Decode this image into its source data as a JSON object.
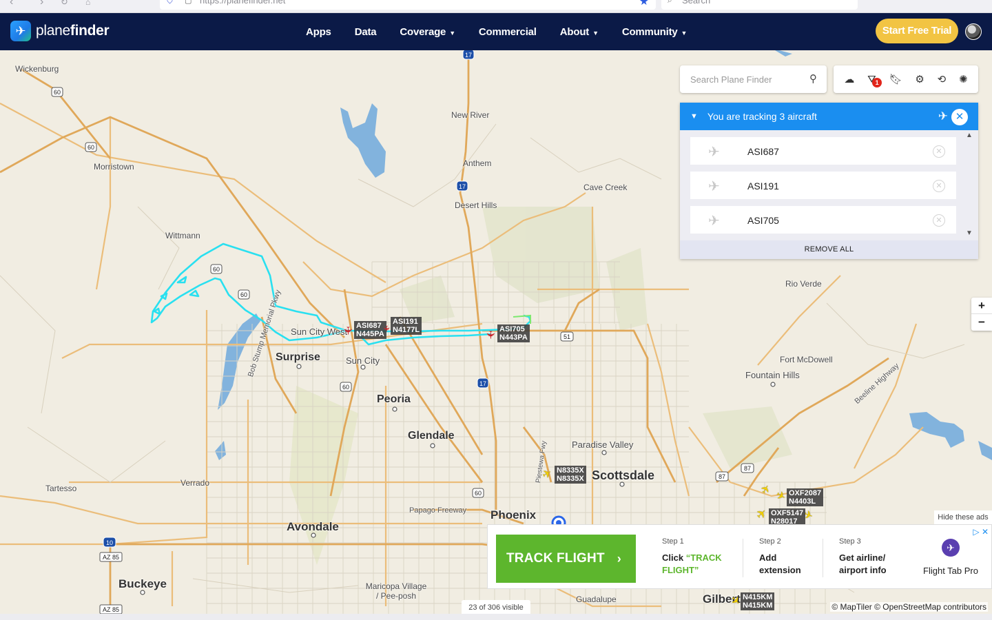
{
  "browser": {
    "url": "https://planefinder.net",
    "search_placeholder": "Search"
  },
  "header": {
    "brand_light": "plane",
    "brand_bold": "finder",
    "nav": [
      {
        "label": "Apps",
        "dropdown": false
      },
      {
        "label": "Data",
        "dropdown": false
      },
      {
        "label": "Coverage",
        "dropdown": true
      },
      {
        "label": "Commercial",
        "dropdown": false
      },
      {
        "label": "About",
        "dropdown": true
      },
      {
        "label": "Community",
        "dropdown": true
      }
    ],
    "cta": "Start Free Trial",
    "colors": {
      "bar": "#0b1a47",
      "cta": "#f2c443"
    }
  },
  "map_search": {
    "placeholder": "Search Plane Finder"
  },
  "toolbar": {
    "icons": [
      "layers-icon",
      "filter-icon",
      "bookmark-icon",
      "settings-icon",
      "history-icon",
      "radar-icon"
    ],
    "filter_badge": "1"
  },
  "tracking": {
    "title": "You are tracking 3 aircraft",
    "aircraft": [
      {
        "callsign": "ASI687"
      },
      {
        "callsign": "ASI191"
      },
      {
        "callsign": "ASI705"
      }
    ],
    "remove_all": "REMOVE ALL",
    "color": "#1a8ef0"
  },
  "zoom": {
    "in": "+",
    "out": "−"
  },
  "places": {
    "wickenburg": "Wickenburg",
    "morristown": "Morristown",
    "wittmann": "Wittmann",
    "new_river": "New River",
    "anthem": "Anthem",
    "desert_hills": "Desert Hills",
    "cave_creek": "Cave Creek",
    "rio_verde": "Rio Verde",
    "fort_mcdowell": "Fort McDowell",
    "fountain_hills": "Fountain Hills",
    "sun_city_west": "Sun City West",
    "surprise": "Surprise",
    "sun_city": "Sun City",
    "peoria": "Peoria",
    "glendale": "Glendale",
    "paradise_valley": "Paradise Valley",
    "scottsdale": "Scottsdale",
    "phoenix": "Phoenix",
    "avondale": "Avondale",
    "tartesso": "Tartesso",
    "verrado": "Verrado",
    "buckeye": "Buckeye",
    "maricopa_village": "Maricopa Village / Pee-posh",
    "guadalupe": "Guadalupe",
    "gilbert": "Gilbert",
    "papago_freeway": "Papago Freeway",
    "beeline_highway": "Beeline Highway",
    "bob_stump": "Bob Stump Memorial Pkwy",
    "piestewa_fwy": "Piestewa Fwy"
  },
  "shields": {
    "us60_a": "60",
    "us60_b": "60",
    "us60_c": "60",
    "us60_d": "60",
    "us60_e": "60",
    "us60_f": "60",
    "i17_a": "17",
    "i17_b": "17",
    "i17_c": "17",
    "sr51": "51",
    "sr87_a": "87",
    "sr87_b": "87",
    "i10": "10",
    "az85_a": "AZ 85",
    "az85_b": "AZ 85"
  },
  "aircraft_labels": [
    {
      "line1": "ASI687",
      "line2": "N445PA"
    },
    {
      "line1": "ASI191",
      "line2": "N4177L"
    },
    {
      "line1": "ASI705",
      "line2": "N443PA"
    },
    {
      "line1": "N8335X",
      "line2": "N8335X"
    },
    {
      "line1": "OXF2087",
      "line2": "N4403L"
    },
    {
      "line1": "OXF5147",
      "line2": "N28017"
    },
    {
      "line1": "N415KM",
      "line2": "N415KM"
    }
  ],
  "ad": {
    "hide": "Hide these ads",
    "cta": "TRACK FLIGHT",
    "step1_num": "Step 1",
    "step1_pre": "Click ",
    "step1_hl": "“TRACK FLIGHT”",
    "step2_num": "Step 2",
    "step2_text": "Add extension",
    "step3_num": "Step 3",
    "step3_text": "Get airline/ airport info",
    "brand": "Flight Tab Pro"
  },
  "footer": {
    "visible_count": "23 of 306 visible",
    "attribution": "© MapTiler © OpenStreetMap contributors"
  },
  "colors": {
    "track": "#29e0f0",
    "map_bg": "#f1ede2",
    "water": "#6fa8dc",
    "arterial": "#e8b870"
  }
}
